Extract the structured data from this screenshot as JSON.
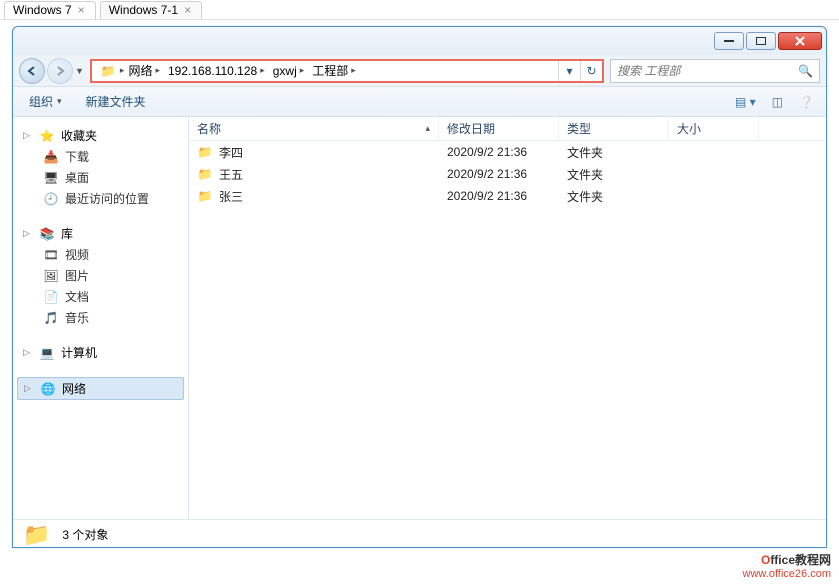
{
  "vm_tabs": [
    {
      "label": "Windows 7",
      "active": true
    },
    {
      "label": "Windows 7-1",
      "active": false
    }
  ],
  "breadcrumbs": [
    "网络",
    "192.168.110.128",
    "gxwj",
    "工程部"
  ],
  "search_placeholder": "搜索 工程部",
  "toolbar": {
    "organize": "组织",
    "new_folder": "新建文件夹"
  },
  "columns": {
    "name": "名称",
    "date": "修改日期",
    "type": "类型",
    "size": "大小"
  },
  "files": [
    {
      "name": "李四",
      "date": "2020/9/2 21:36",
      "type": "文件夹"
    },
    {
      "name": "王五",
      "date": "2020/9/2 21:36",
      "type": "文件夹"
    },
    {
      "name": "张三",
      "date": "2020/9/2 21:36",
      "type": "文件夹"
    }
  ],
  "sidebar": {
    "favorites": {
      "label": "收藏夹",
      "items": [
        "下载",
        "桌面",
        "最近访问的位置"
      ]
    },
    "libraries": {
      "label": "库",
      "items": [
        "视频",
        "图片",
        "文档",
        "音乐"
      ]
    },
    "computer": {
      "label": "计算机"
    },
    "network": {
      "label": "网络"
    }
  },
  "status": "3 个对象",
  "watermark": {
    "line1_pre": "O",
    "line1": "ffice教程网",
    "line2": "www.office26.com"
  }
}
